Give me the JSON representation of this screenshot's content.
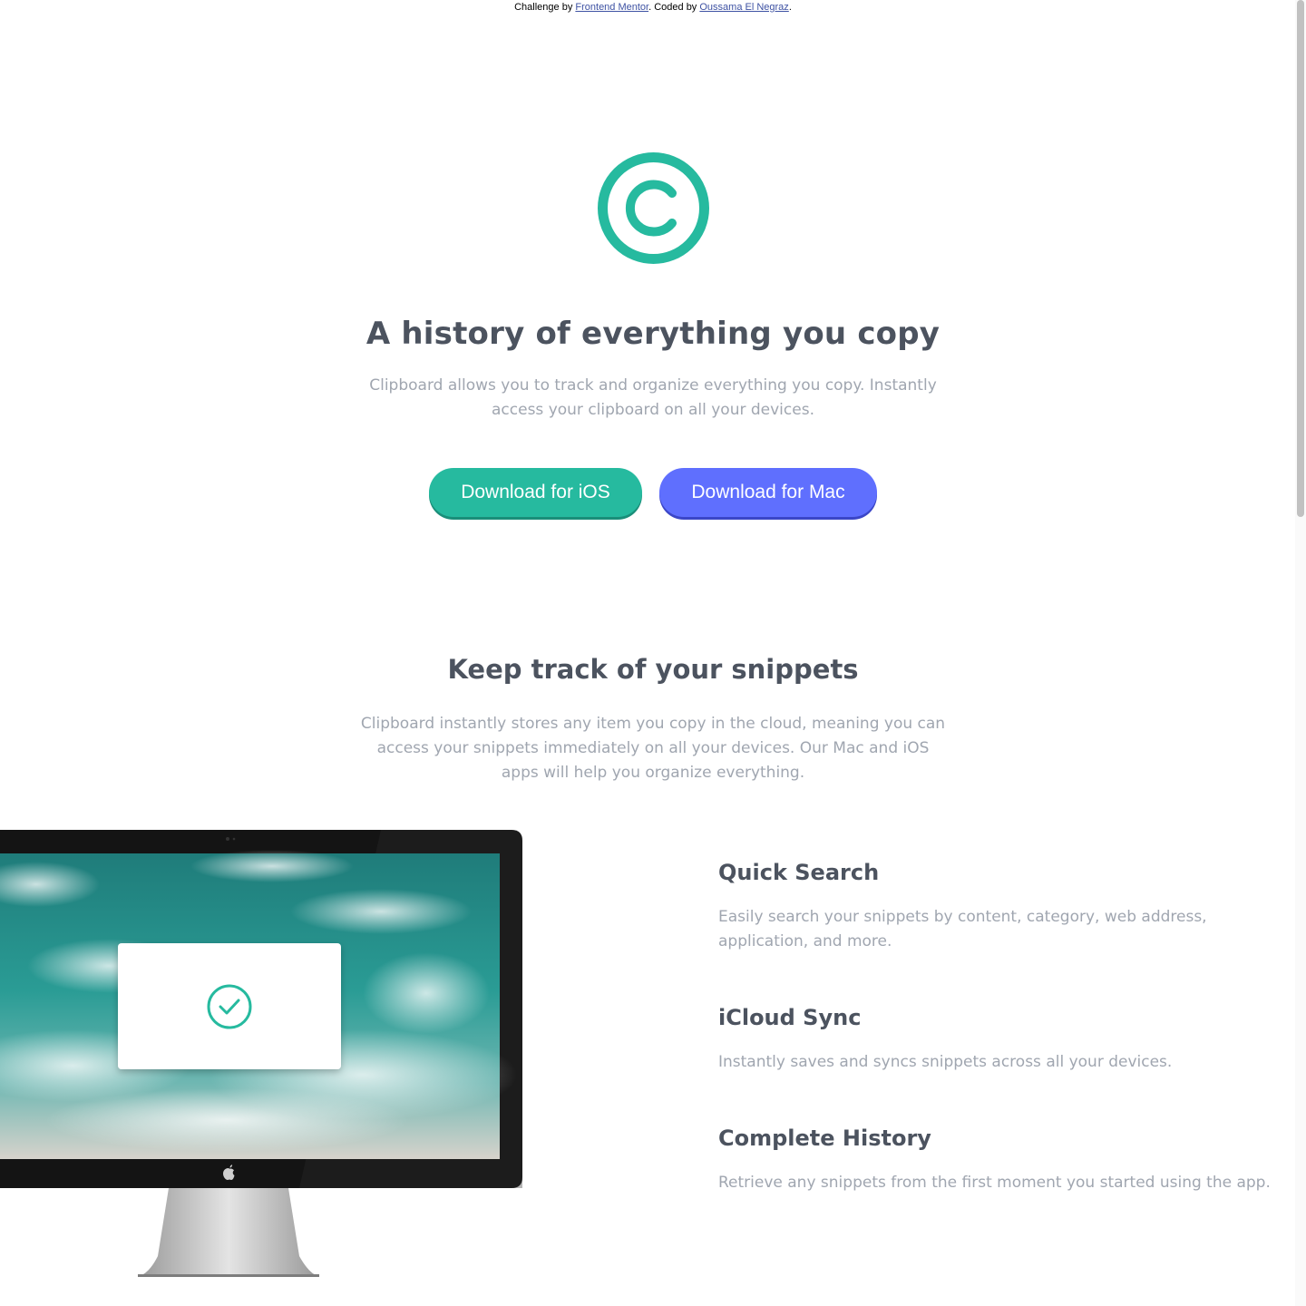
{
  "attribution": {
    "prefix": "Challenge by ",
    "mentor_link": "Frontend Mentor",
    "middle": ". Coded by ",
    "author_link": "Oussama El Negraz",
    "suffix": "."
  },
  "hero": {
    "logo_icon": "copyright-icon",
    "title": "A history of everything you copy",
    "text": "Clipboard allows you to track and organize everything you copy. Instantly access your clipboard on all your devices.",
    "ios_button": "Download for iOS",
    "mac_button": "Download for Mac"
  },
  "snippets": {
    "title": "Keep track of your snippets",
    "text": "Clipboard instantly stores any item you copy in the cloud, meaning you can access your snippets immediately on all your devices. Our Mac and iOS apps will help you organize everything.",
    "monitor_icons": [
      "apple-icon",
      "checkmark-icon"
    ],
    "features": [
      {
        "title": "Quick Search",
        "text": "Easily search your snippets by content, category, web address, application, and more."
      },
      {
        "title": "iCloud Sync",
        "text": "Instantly saves and syncs snippets across all your devices."
      },
      {
        "title": "Complete History",
        "text": "Retrieve any snippets from the first moment you started using the app."
      }
    ]
  },
  "colors": {
    "accent_green": "#26ba9f",
    "accent_blue": "#5f6ffe",
    "heading": "#4c535f",
    "body_text": "#a0a6b0"
  }
}
